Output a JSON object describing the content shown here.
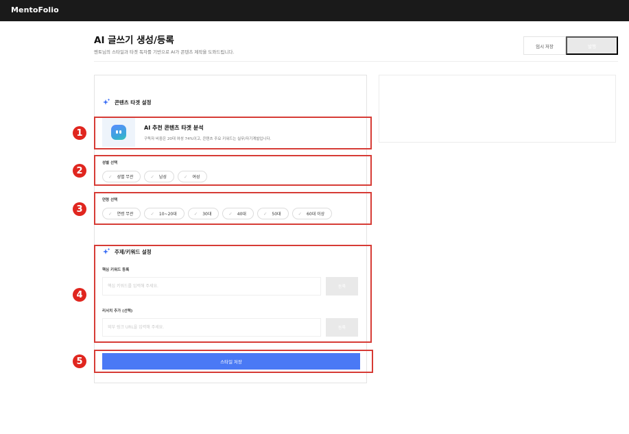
{
  "app": {
    "brand": "MentoFolio"
  },
  "header": {
    "title": "AI 글쓰기 생성/등록",
    "subtitle": "멘토님의 스타일과 타겟 독자를 기반으로 AI가 콘텐츠 제작을 도와드립니다.",
    "temp_save_label": "임시 저장",
    "publish_label": "발행"
  },
  "target_section": {
    "title": "콘텐츠 타겟 설정",
    "ai_card": {
      "title": "AI 추천 콘텐츠 타겟 분석",
      "description": "구독자 비중은 20대 여성 74%이고, 콘텐츠 주요 키워드는 실무/자기계발입니다."
    },
    "gender": {
      "label": "성별 선택",
      "options": [
        "성별 무관",
        "남성",
        "여성"
      ]
    },
    "age": {
      "label": "연령 선택",
      "options": [
        "연령 무관",
        "10~20대",
        "30대",
        "40대",
        "50대",
        "60대 이상"
      ]
    }
  },
  "keyword_section": {
    "title": "주제/키워드 설정",
    "core_keyword": {
      "label": "핵심 키워드 등록",
      "placeholder": "핵심 키워드를 입력해 주세요.",
      "button": "등록"
    },
    "research": {
      "label": "리서치 추가 (선택)",
      "placeholder": "외부 링크 URL을 입력해 주세요.",
      "button": "등록"
    }
  },
  "save_style_label": "스타일 저장",
  "annotations": [
    "1",
    "2",
    "3",
    "4",
    "5"
  ],
  "colors": {
    "accent": "#4a79f5",
    "annotation_red": "#d63a34",
    "topbar": "#1a1a1a"
  },
  "icons": {
    "sparkle": "sparkle-icon",
    "check": "check-icon",
    "ai_avatar": "ai-bot-icon"
  }
}
